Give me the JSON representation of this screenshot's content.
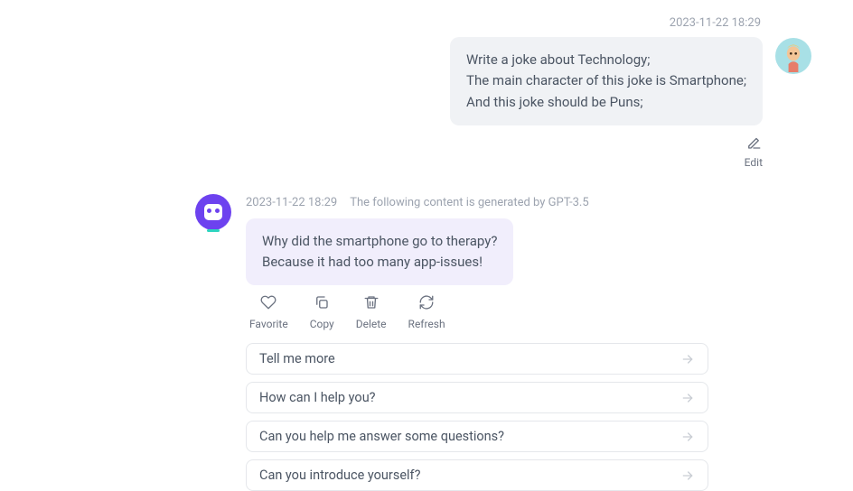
{
  "user_message": {
    "timestamp": "2023-11-22 18:29",
    "line1": "Write a joke about Technology;",
    "line2": "The main character of this joke is Smartphone;",
    "line3": "And this joke should be Puns;",
    "edit_label": "Edit"
  },
  "assistant_message": {
    "timestamp": "2023-11-22 18:29",
    "gen_notice": "The following content is generated by GPT-3.5",
    "line1": "Why did the smartphone go to therapy?",
    "line2": "Because it had too many app-issues!"
  },
  "actions": {
    "favorite": "Favorite",
    "copy": "Copy",
    "delete": "Delete",
    "refresh": "Refresh"
  },
  "suggestions": [
    "Tell me more",
    "How can I help you?",
    "Can you help me answer some questions?",
    "Can you introduce yourself?"
  ]
}
